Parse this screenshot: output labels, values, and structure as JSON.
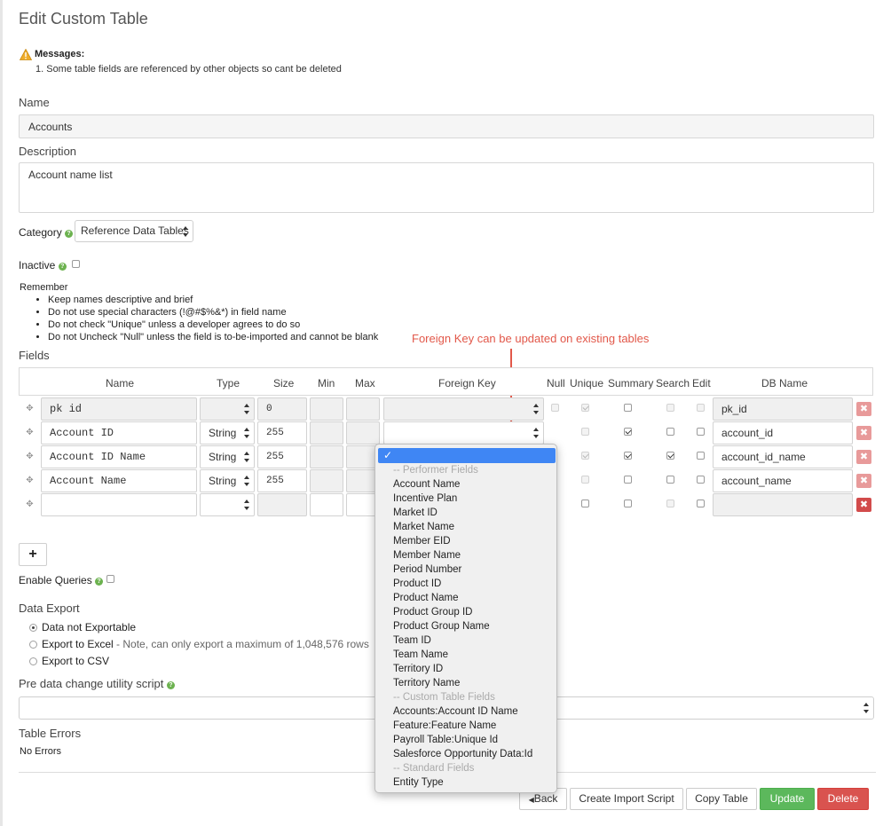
{
  "page": {
    "title": "Edit Custom Table"
  },
  "messages": {
    "title": "Messages:",
    "items": [
      "1. Some table fields are referenced by other objects so cant be deleted"
    ]
  },
  "name": {
    "label": "Name",
    "value": "Accounts"
  },
  "description": {
    "label": "Description",
    "value": "Account name list"
  },
  "category": {
    "label": "Category",
    "value": "Reference Data Tables"
  },
  "inactive": {
    "label": "Inactive",
    "checked": false
  },
  "remember": {
    "title": "Remember",
    "items": [
      "Keep names descriptive and brief",
      "Do not use special characters (!@#$%&*) in field name",
      "Do not check \"Unique\" unless a developer agrees to do so",
      "Do not Uncheck \"Null\" unless the field is to-be-imported and cannot be blank"
    ]
  },
  "annotation": {
    "text": "Foreign Key can be updated on existing tables",
    "color": "#e2584a"
  },
  "fields": {
    "label": "Fields",
    "headers": {
      "name": "Name",
      "type": "Type",
      "size": "Size",
      "min": "Min",
      "max": "Max",
      "foreign_key": "Foreign Key",
      "null": "Null",
      "unique": "Unique",
      "summary": "Summary",
      "search": "Search",
      "edit": "Edit",
      "db_name": "DB Name"
    },
    "rows": [
      {
        "name": "pk id",
        "type": "",
        "size": "0",
        "db_name": "pk_id"
      },
      {
        "name": "Account ID",
        "type": "String",
        "size": "255",
        "db_name": "account_id"
      },
      {
        "name": "Account ID Name",
        "type": "String",
        "size": "255",
        "db_name": "account_id_name"
      },
      {
        "name": "Account Name",
        "type": "String",
        "size": "255",
        "db_name": "account_name"
      },
      {
        "name": "",
        "type": "",
        "size": "",
        "db_name": ""
      }
    ],
    "add_label": "+"
  },
  "foreign_key_dropdown": {
    "groups": [
      {
        "label": "-- Performer Fields",
        "options": [
          "Account Name",
          "Incentive Plan",
          "Market ID",
          "Market Name",
          "Member EID",
          "Member Name",
          "Period Number",
          "Product ID",
          "Product Name",
          "Product Group ID",
          "Product Group Name",
          "Team ID",
          "Team Name",
          "Territory ID",
          "Territory Name"
        ]
      },
      {
        "label": "-- Custom Table Fields",
        "options": [
          "Accounts:Account ID Name",
          "Feature:Feature Name",
          "Payroll Table:Unique Id",
          "Salesforce Opportunity Data:Id"
        ]
      },
      {
        "label": "-- Standard Fields",
        "options": [
          "Entity Type"
        ]
      }
    ]
  },
  "enable_queries": {
    "label": "Enable Queries",
    "checked": false
  },
  "data_export": {
    "label": "Data Export",
    "options": [
      {
        "label": "Data not Exportable",
        "note": "",
        "selected": true
      },
      {
        "label": "Export to Excel",
        "note": " - Note, can only export a maximum of 1,048,576 rows",
        "selected": false
      },
      {
        "label": "Export to CSV",
        "note": "",
        "selected": false
      }
    ]
  },
  "pre_script": {
    "label": "Pre data change utility script",
    "value": ""
  },
  "table_errors": {
    "label": "Table Errors",
    "value": "No Errors"
  },
  "buttons": {
    "back": "Back",
    "create_import": "Create Import Script",
    "copy": "Copy Table",
    "update": "Update",
    "delete": "Delete"
  },
  "colors": {
    "update": "#5cb85c",
    "delete": "#d9534f",
    "help": "#6cb24f",
    "selected_option": "#3f86f4"
  }
}
